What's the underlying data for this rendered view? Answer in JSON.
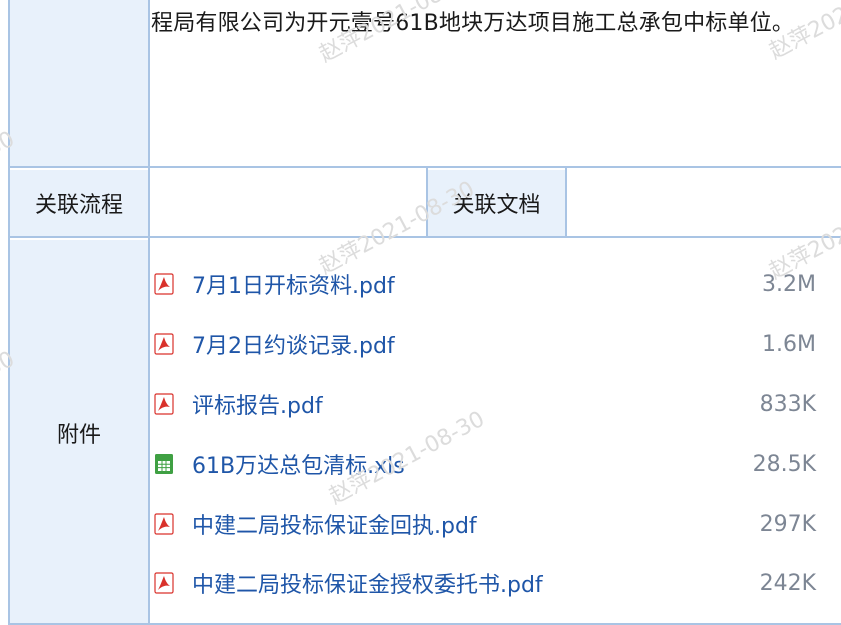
{
  "summary": {
    "text": "程局有限公司为开元壹号61B地块万达项目施工总承包中标单位。"
  },
  "related": {
    "process_label": "关联流程",
    "process_value": "",
    "doc_label": "关联文档",
    "doc_value": ""
  },
  "attachments": {
    "label": "附件",
    "files": [
      {
        "name": "7月1日开标资料.pdf",
        "size": "3.2M",
        "type": "pdf"
      },
      {
        "name": "7月2日约谈记录.pdf",
        "size": "1.6M",
        "type": "pdf"
      },
      {
        "name": "评标报告.pdf",
        "size": "833K",
        "type": "pdf"
      },
      {
        "name": "61B万达总包清标.xls",
        "size": "28.5K",
        "type": "xls"
      },
      {
        "name": "中建二局投标保证金回执.pdf",
        "size": "297K",
        "type": "pdf"
      },
      {
        "name": "中建二局投标保证金授权委托书.pdf",
        "size": "242K",
        "type": "pdf"
      }
    ]
  },
  "watermark": {
    "text": "赵萍2021-08-30"
  },
  "colors": {
    "label_bg": "#e8f1fb",
    "border": "#a9c4e4",
    "link": "#1f56a8",
    "pdf_icon": "#d9312b",
    "xls_icon": "#3fa043"
  }
}
